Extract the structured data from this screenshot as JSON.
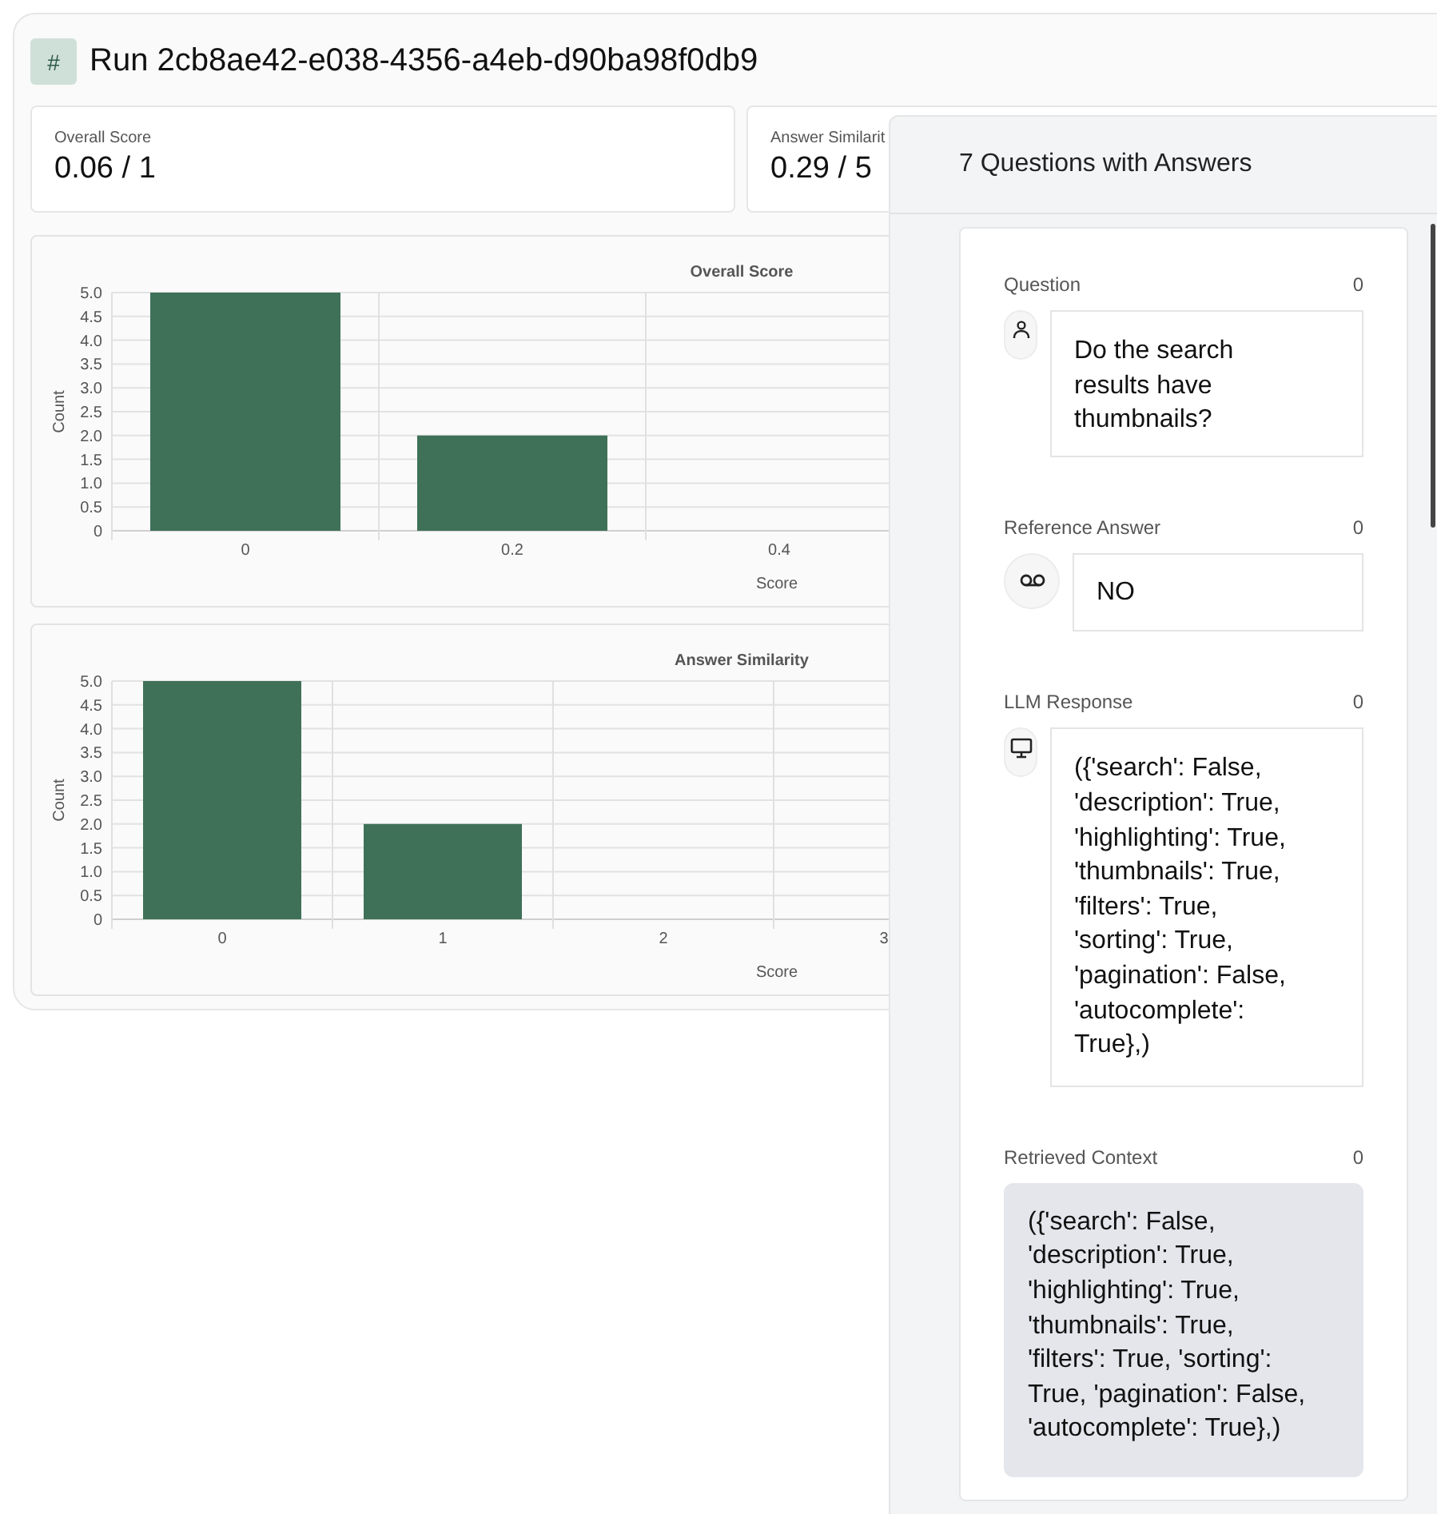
{
  "run": {
    "badge": "#",
    "title": "Run 2cb8ae42-e038-4356-a4eb-d90ba98f0db9"
  },
  "stats": [
    {
      "label": "Overall Score",
      "value": "0.06 / 1"
    },
    {
      "label": "Answer Similarit",
      "value": "0.29 / 5"
    }
  ],
  "charts": [
    {
      "chart_data": {
        "type": "bar",
        "title": "Overall Score",
        "xlabel": "Score",
        "ylabel": "Count",
        "categories": [
          "0",
          "0.2",
          "0.4"
        ],
        "values": [
          5,
          2,
          0
        ],
        "ylim": [
          0,
          5
        ],
        "grid": true,
        "yticks": [
          0,
          0.5,
          {
            "value": 1,
            "label": "1.0"
          },
          1.5,
          {
            "value": 2,
            "label": "2.0"
          },
          2.5,
          {
            "value": 3,
            "label": "3.0"
          },
          3.5,
          {
            "value": 4,
            "label": "4.0"
          },
          4.5,
          {
            "value": 5,
            "label": "5.0"
          }
        ]
      }
    },
    {
      "chart_data": {
        "type": "bar",
        "title": "Answer Similarity",
        "xlabel": "Score",
        "ylabel": "Count",
        "categories": [
          "0",
          "1",
          "2",
          "3"
        ],
        "values": [
          5,
          2,
          0,
          0
        ],
        "ylim": [
          0,
          5
        ],
        "grid": true,
        "yticks": [
          0,
          0.5,
          {
            "value": 1,
            "label": "1.0"
          },
          1.5,
          {
            "value": 2,
            "label": "2.0"
          },
          2.5,
          {
            "value": 3,
            "label": "3.0"
          },
          3.5,
          {
            "value": 4,
            "label": "4.0"
          },
          4.5,
          {
            "value": 5,
            "label": "5.0"
          }
        ]
      }
    }
  ],
  "panel": {
    "title": "7 Questions with Answers",
    "items": [
      {
        "kind": "question",
        "label": "Question",
        "count": "0",
        "text": "Do the search results have thumbnails?"
      },
      {
        "kind": "reference",
        "label": "Reference Answer",
        "count": "0",
        "text": "NO"
      },
      {
        "kind": "response",
        "label": "LLM Response",
        "count": "0",
        "text": "({'search': False, 'description': True, 'highlighting': True, 'thumbnails': True, 'filters': True, 'sorting': True, 'pagination': False, 'autocomplete': True},)"
      },
      {
        "kind": "context",
        "label": "Retrieved Context",
        "count": "0",
        "text": "({'search': False, 'description': True, 'highlighting': True, 'thumbnails': True, 'filters': True, 'sorting': True, 'pagination': False, 'autocomplete': True},)"
      }
    ]
  }
}
